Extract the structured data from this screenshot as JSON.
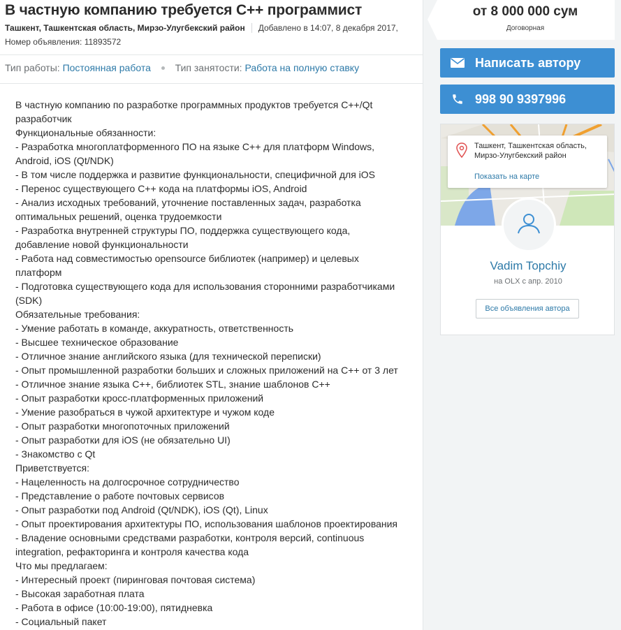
{
  "listing": {
    "title": "В частную компанию требуется С++ программист",
    "location": "Ташкент, Ташкентская область, Мирзо-Улугбекский район",
    "added": "Добавлено в 14:07, 8 декабря 2017,",
    "ad_number": "Номер объявления: 11893572"
  },
  "params": {
    "work_type_label": "Тип работы:",
    "work_type_value": "Постоянная работа",
    "employment_label": "Тип занятости:",
    "employment_value": "Работа на полную ставку"
  },
  "description": [
    "В частную компанию по разработке программных продуктов требуется C++/Qt разработчик",
    "Функциональные обязанности:",
    "- Разработка многоплатформенного ПО на языке C++ для платформ Windows, Android, iOS (Qt/NDK)",
    "- В том числе поддержка и развитие функциональности, специфичной для iOS",
    "- Перенос существующего C++ кода на платформы iOS, Android",
    "- Анализ исходных требований, уточнение поставленных задач, разработка оптимальных решений, оценка трудоемкости",
    "- Разработка внутренней структуры ПО, поддержка существующего кода, добавление новой функциональности",
    "- Работа над совместимостью opensource библиотек (например) и целевых платформ",
    "- Подготовка существующего кода для использования сторонними разработчиками (SDK)",
    "Обязательные требования:",
    "- Умение работать в команде, аккуратность, ответственность",
    "- Высшее техническое образование",
    "- Отличное знание английского языка (для технической переписки)",
    "- Опыт промышленной разработки больших и сложных приложений на C++ от 3 лет",
    "- Отличное знание языка C++, библиотек STL, знание шаблонов C++",
    "- Опыт разработки кросс-платформенных приложений",
    "- Умение разобраться в чужой архитектуре и чужом коде",
    "- Опыт разработки многопоточных приложений",
    "- Опыт разработки для iOS (не обязательно UI)",
    "- Знакомство с Qt",
    "Приветствуется:",
    "- Нацеленность на долгосрочное сотрудничество",
    "- Представление о работе почтовых сервисов",
    "- Опыт разработки под Android (Qt/NDK), iOS (Qt), Linux",
    "- Опыт проектирования архитектуры ПО, использования шаблонов проектирования",
    "- Владение основными средствами разработки, контроля версий, continuous integration, рефакторинга и контроля качества кода",
    "Что мы предлагаем:",
    "- Интересный проект (пиринговая почтовая система)",
    "- Высокая заработная плата",
    "- Работа в офисе (10:00-19:00), пятидневка",
    "- Социальный пакет"
  ],
  "sidebar": {
    "price": "от 8 000 000 сум",
    "price_note": "Договорная",
    "message_button": "Написать автору",
    "phone_button": "998 90 9397996",
    "map_address": "Ташкент, Ташкентская область, Мирзо-Улугбекский район",
    "map_link": "Показать на карте",
    "user_name": "Vadim Topchiy",
    "user_since": "на OLX с апр. 2010",
    "all_ads_button": "Все объявления автора"
  },
  "colors": {
    "accent": "#3d8fd3",
    "link": "#2e7aa8",
    "map_road": "#f0a030",
    "map_water": "#7da7e8",
    "map_park": "#cfe7b9"
  },
  "icons": [
    "envelope-icon",
    "phone-icon",
    "map-pin-icon",
    "user-icon"
  ]
}
